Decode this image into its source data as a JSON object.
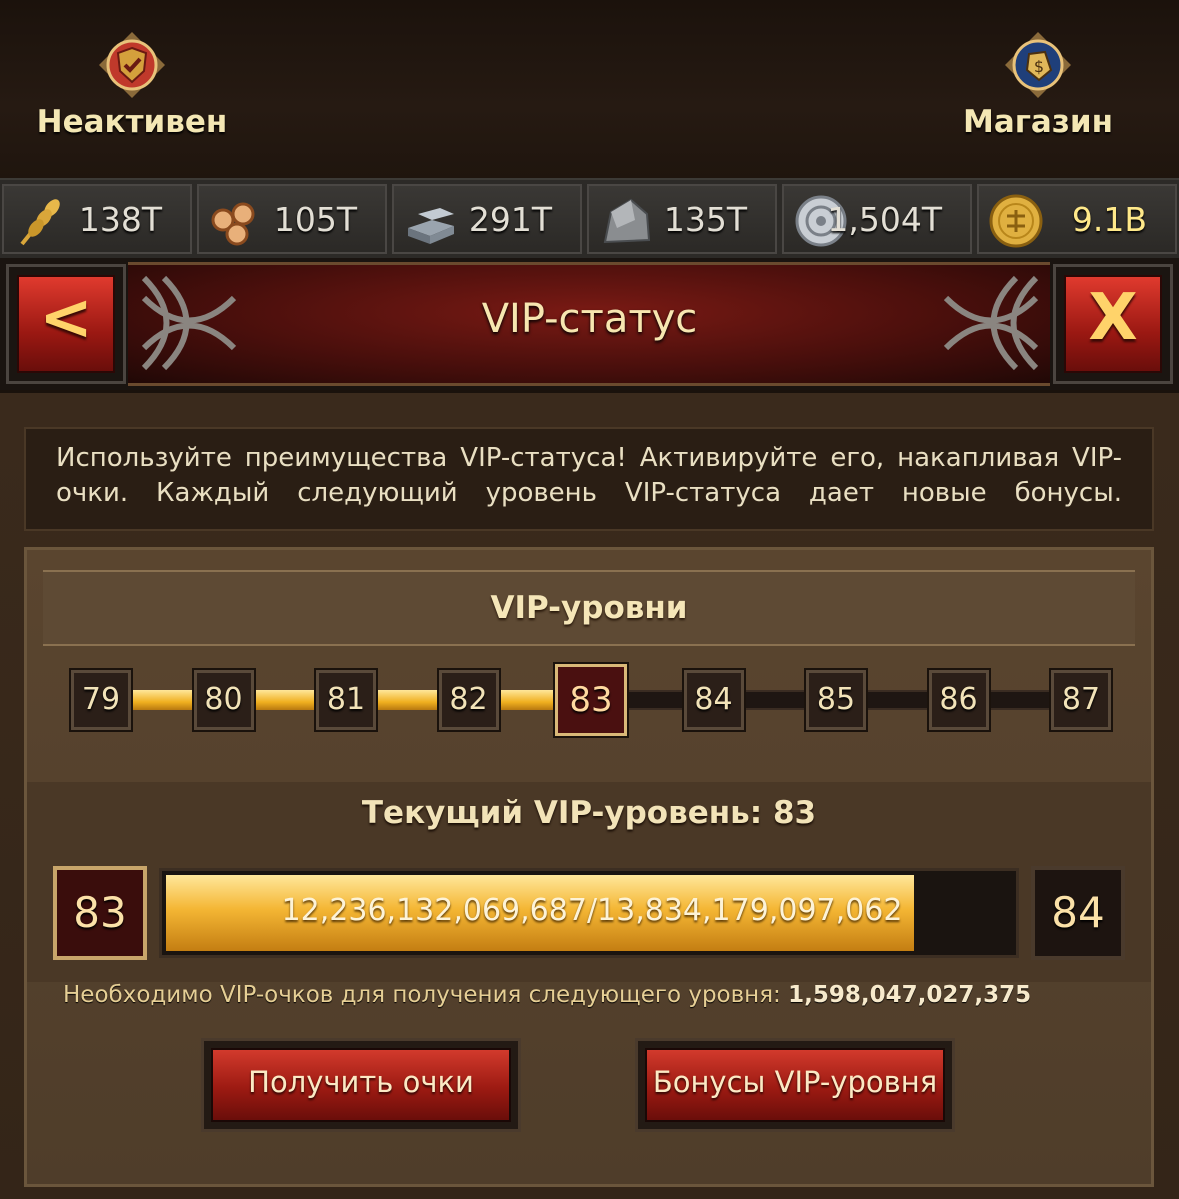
{
  "top": {
    "left_label": "Неактивен",
    "right_label": "Магазин"
  },
  "resources": [
    {
      "name": "wheat-icon",
      "value": "138T"
    },
    {
      "name": "wood-icon",
      "value": "105T"
    },
    {
      "name": "iron-icon",
      "value": "291T"
    },
    {
      "name": "stone-icon",
      "value": "135T"
    },
    {
      "name": "silver-icon",
      "value": "1,504T"
    },
    {
      "name": "gold-coin-icon",
      "value": "9.1B"
    }
  ],
  "header": {
    "title": "VIP-статус",
    "back_glyph": "<",
    "close_glyph": "X"
  },
  "intro_text": "Используйте преимущества VIP-статуса! Активируйте его, накапливая VIP-очки. Каждый следующий уровень VIP-статуса дает новые бонусы.",
  "vip": {
    "section_title": "VIP-уровни",
    "levels": [
      "79",
      "80",
      "81",
      "82",
      "83",
      "84",
      "85",
      "86",
      "87"
    ],
    "current_index": 4,
    "current_label": "Текущий VIP-уровень: 83",
    "current_level": "83",
    "next_level": "84",
    "progress_text": "12,236,132,069,687/13,834,179,097,062",
    "progress_fraction": 0.8845,
    "need_label": "Необходимо VIP-очков для получения следующего уровня:",
    "need_value": "1,598,047,027,375",
    "get_points_label": "Получить очки",
    "bonuses_label": "Бонусы VIP-уровня"
  },
  "colors": {
    "accent_gold": "#f0b020",
    "button_red": "#9c1a12",
    "text_cream": "#f2e3b8"
  }
}
